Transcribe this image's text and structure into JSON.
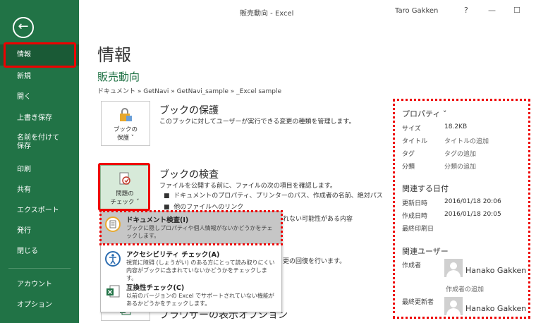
{
  "window": {
    "title": "販売動向 - Excel",
    "user": "Taro Gakken",
    "help": "?",
    "minimize": "—",
    "maximize": "☐"
  },
  "sidebar": {
    "back_icon": "back-arrow-icon",
    "items": [
      {
        "label": "情報",
        "active": true
      },
      {
        "label": "新規"
      },
      {
        "label": "開く"
      },
      {
        "label": "上書き保存"
      },
      {
        "label": "名前を付けて\n保存"
      },
      {
        "label": "印刷"
      },
      {
        "label": "共有"
      },
      {
        "label": "エクスポート"
      },
      {
        "label": "発行"
      },
      {
        "label": "閉じる"
      },
      {
        "label": "アカウント"
      },
      {
        "label": "オプション"
      }
    ],
    "bg_color": "#217346"
  },
  "main": {
    "heading": "情報",
    "workbook_name": "販売動向",
    "breadcrumb": "ドキュメント » GetNavi » GetNavi_sample » _Excel sample",
    "protect": {
      "button_line1": "ブックの",
      "button_line2": "保護 ˅",
      "title": "ブックの保護",
      "desc": "このブックに対してユーザーが実行できる変更の種類を管理します。"
    },
    "inspect": {
      "button_line1": "問題の",
      "button_line2": "チェック ˅",
      "title": "ブックの検査",
      "desc": "ファイルを公開する前に、ファイルの次の項目を確認します。",
      "bullets": [
        "ドキュメントのプロパティ、プリンターのパス、作成者の名前、絶対パス",
        "他のファイルへのリンク"
      ],
      "hidden_text_1": "れない可能性がある内容",
      "hidden_text_2": "更の回復を行います。"
    },
    "browser": {
      "title": "ブラウザーの表示オプション"
    }
  },
  "dropdown": {
    "items": [
      {
        "title": "ドキュメント検査(I)",
        "desc": "ブックに隠しプロパティや個人情報がないかどうかをチェックします。",
        "icon": "document-inspect-icon"
      },
      {
        "title": "アクセシビリティ チェック(A)",
        "desc": "視覚に障碍 (しょうがい) のある方にとって読み取りにくい内容がブックに含まれていないかどうかをチェックします。",
        "icon": "accessibility-icon"
      },
      {
        "title": "互換性チェック(C)",
        "desc": "以前のバージョンの Excel でサポートされていない機能があるかどうかをチェックします。",
        "icon": "compatibility-icon"
      }
    ]
  },
  "properties": {
    "heading": "プロパティ ˅",
    "rows": [
      {
        "label": "サイズ",
        "value": "18.2KB"
      },
      {
        "label": "タイトル",
        "value": "タイトルの追加"
      },
      {
        "label": "タグ",
        "value": "タグの追加"
      },
      {
        "label": "分類",
        "value": "分類の追加"
      }
    ],
    "dates_heading": "関連する日付",
    "dates": [
      {
        "label": "更新日時",
        "value": "2016/01/18 20:06"
      },
      {
        "label": "作成日時",
        "value": "2016/01/18 20:05"
      },
      {
        "label": "最終印刷日",
        "value": ""
      }
    ],
    "users_heading": "関連ユーザー",
    "author_label": "作成者",
    "author_name": "Hanako Gakken",
    "add_author": "作成者の追加",
    "last_modified_label": "最終更新者",
    "last_modified_name": "Hanako Gakken"
  }
}
